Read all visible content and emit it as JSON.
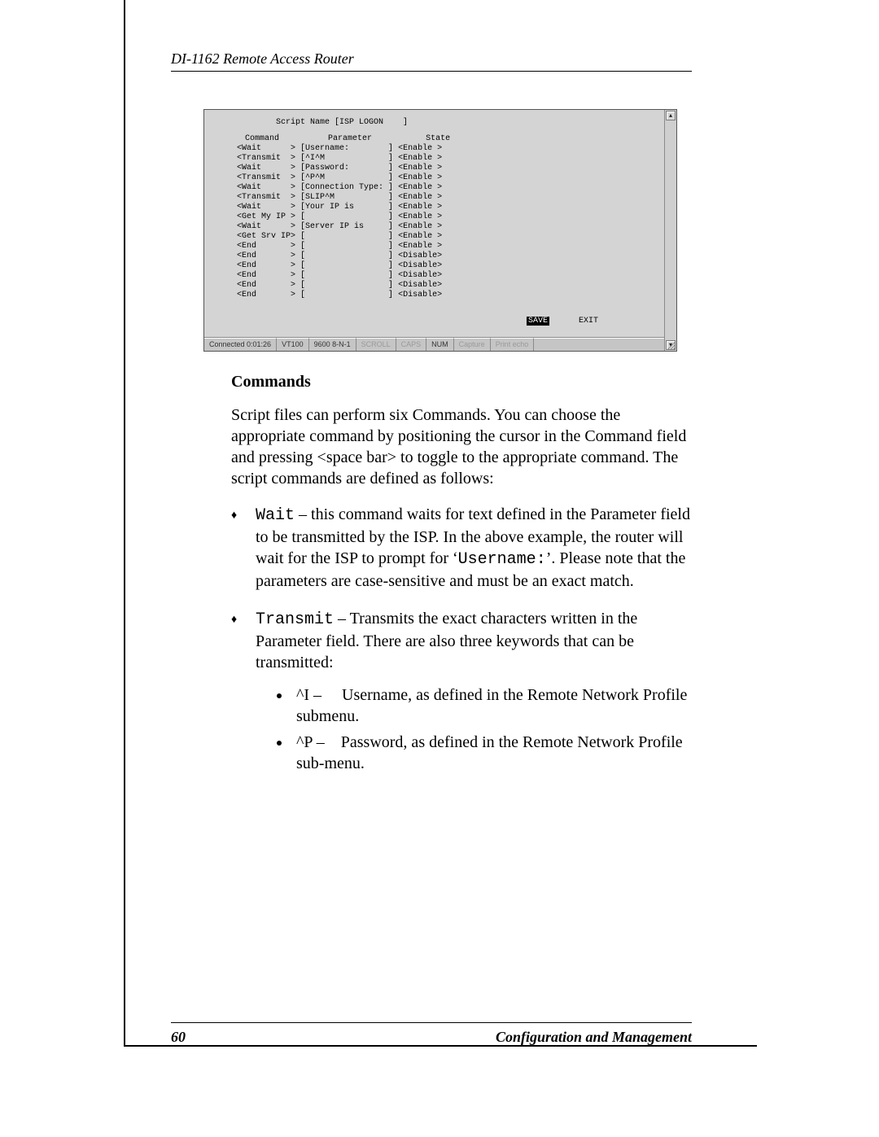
{
  "header": {
    "title": "DI-1162 Remote Access Router"
  },
  "terminal": {
    "script_name_label": "Script Name [ISP LOGON    ]",
    "columns": {
      "c1": "Command",
      "c2": "Parameter",
      "c3": "State"
    },
    "rows": [
      {
        "cmd": "<Wait      >",
        "param": "[Username:        ]",
        "state": "<Enable >"
      },
      {
        "cmd": "<Transmit  >",
        "param": "[^I^M             ]",
        "state": "<Enable >"
      },
      {
        "cmd": "<Wait      >",
        "param": "[Password:        ]",
        "state": "<Enable >"
      },
      {
        "cmd": "<Transmit  >",
        "param": "[^P^M             ]",
        "state": "<Enable >"
      },
      {
        "cmd": "<Wait      >",
        "param": "[Connection Type: ]",
        "state": "<Enable >"
      },
      {
        "cmd": "<Transmit  >",
        "param": "[SLIP^M           ]",
        "state": "<Enable >"
      },
      {
        "cmd": "<Wait      >",
        "param": "[Your IP is       ]",
        "state": "<Enable >"
      },
      {
        "cmd": "<Get My IP >",
        "param": "[                 ]",
        "state": "<Enable >"
      },
      {
        "cmd": "<Wait      >",
        "param": "[Server IP is     ]",
        "state": "<Enable >"
      },
      {
        "cmd": "<Get Srv IP>",
        "param": "[                 ]",
        "state": "<Enable >"
      },
      {
        "cmd": "<End       >",
        "param": "[                 ]",
        "state": "<Enable >"
      },
      {
        "cmd": "<End       >",
        "param": "[                 ]",
        "state": "<Disable>"
      },
      {
        "cmd": "<End       >",
        "param": "[                 ]",
        "state": "<Disable>"
      },
      {
        "cmd": "<End       >",
        "param": "[                 ]",
        "state": "<Disable>"
      },
      {
        "cmd": "<End       >",
        "param": "[                 ]",
        "state": "<Disable>"
      },
      {
        "cmd": "<End       >",
        "param": "[                 ]",
        "state": "<Disable>"
      }
    ],
    "buttons": {
      "save": "SAVE",
      "exit": "EXIT"
    },
    "scroll": {
      "up": "▴",
      "down": "▾"
    },
    "status": {
      "connected": "Connected 0:01:26",
      "term": "VT100",
      "baud": "9600 8-N-1",
      "scroll": "SCROLL",
      "caps": "CAPS",
      "num": "NUM",
      "capture": "Capture",
      "printecho": "Print echo"
    }
  },
  "section": {
    "title": "Commands"
  },
  "paragraph": "Script files can perform six Commands. You can choose the appropriate command by positioning the cursor in the Command field and pressing <space bar> to toggle to the appropriate command. The script commands are defined as follows:",
  "cmds": {
    "wait_code": "Wait",
    "wait_text": " – this command waits for text defined in the Parameter field to be transmitted by the ISP. In the above example, the router will wait for the ISP to prompt for ‘",
    "wait_code2": "Username:",
    "wait_text2": "’. Please note that the parameters are case-sensitive and must be an exact match.",
    "tx_code": "Transmit",
    "tx_text": " – Transmits the exact characters written in the Parameter field. There are also three keywords that can be transmitted:",
    "sub": {
      "i_lead": "^I – ",
      "i_text": "Username, as defined in the Remote Network Profile submenu.",
      "p_lead": "^P – ",
      "p_text": "Password, as defined in the Remote Network Profile sub-menu."
    }
  },
  "footer": {
    "page": "60",
    "section": "Configuration and Management"
  }
}
